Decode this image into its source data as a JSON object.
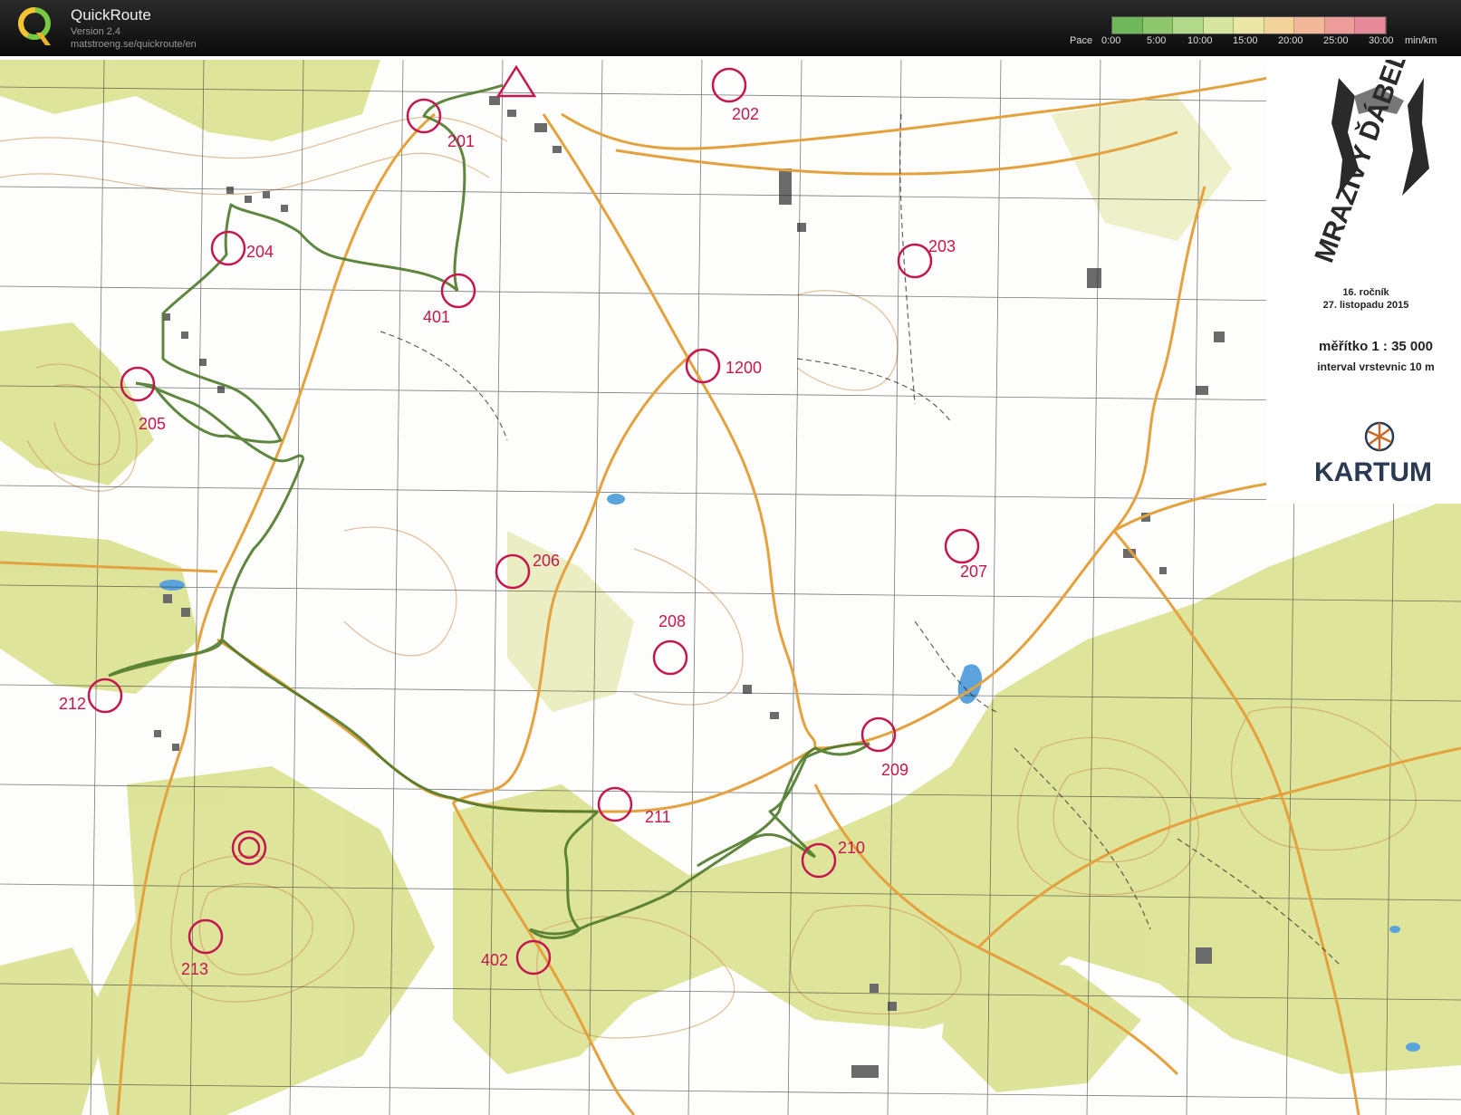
{
  "app": {
    "title": "QuickRoute",
    "version": "Version 2.4",
    "url": "matstroeng.se/quickroute/en"
  },
  "pace_legend": {
    "label": "Pace",
    "ticks": [
      "0:00",
      "5:00",
      "10:00",
      "15:00",
      "20:00",
      "25:00",
      "30:00"
    ],
    "unit": "min/km",
    "colors": [
      "#6fb85a",
      "#8ec86a",
      "#b3d98a",
      "#d6e6a0",
      "#ece6a4",
      "#f2d39a",
      "#f3b79a",
      "#ef9d9a",
      "#e88a9a"
    ]
  },
  "map": {
    "event_title": "MRAZIVÝ ĎÁBEL",
    "edition": "16. ročník",
    "date": "27. listopadu 2015",
    "scale": "měřítko 1 : 35 000",
    "contour_interval": "interval vrstevnic 10 m",
    "publisher": "KARTUM",
    "colors": {
      "control": "#c5164f",
      "route": "#4f7a2a",
      "forest": "#d8df86",
      "road": "#e4a23e"
    },
    "controls": [
      {
        "label": "201"
      },
      {
        "label": "202"
      },
      {
        "label": "203"
      },
      {
        "label": "204"
      },
      {
        "label": "401"
      },
      {
        "label": "1200"
      },
      {
        "label": "205"
      },
      {
        "label": "206"
      },
      {
        "label": "207"
      },
      {
        "label": "208"
      },
      {
        "label": "212"
      },
      {
        "label": "209"
      },
      {
        "label": "211"
      },
      {
        "label": "210"
      },
      {
        "label": "213"
      },
      {
        "label": "402"
      },
      {
        "label": ""
      }
    ]
  }
}
